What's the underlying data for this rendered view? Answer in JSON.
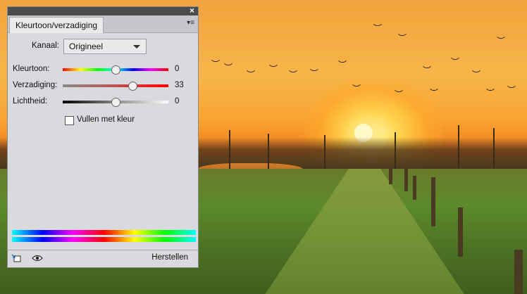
{
  "panel": {
    "tab_title": "Kleurtoon/verzadiging",
    "channel_label": "Kanaal:",
    "channel_value": "Origineel",
    "hue": {
      "label": "Kleurtoon:",
      "value": "0",
      "level": 0.5
    },
    "saturation": {
      "label": "Verzadiging:",
      "value": "33",
      "level": 0.66
    },
    "lightness": {
      "label": "Lichtheid:",
      "value": "0",
      "level": 0.5
    },
    "colorize_label": "Vullen met kleur",
    "colorize_checked": false,
    "reset_label": "Herstellen"
  },
  "icons": {
    "close": "close-icon",
    "menu": "panel-menu-icon",
    "clip": "clip-to-layer-icon",
    "eye": "visibility-eye-icon"
  },
  "colors": {
    "panel_bg": "#d9dadd",
    "panel_header": "#4b4b4b",
    "sky": "#f6b54a",
    "grass": "#4e7424"
  }
}
